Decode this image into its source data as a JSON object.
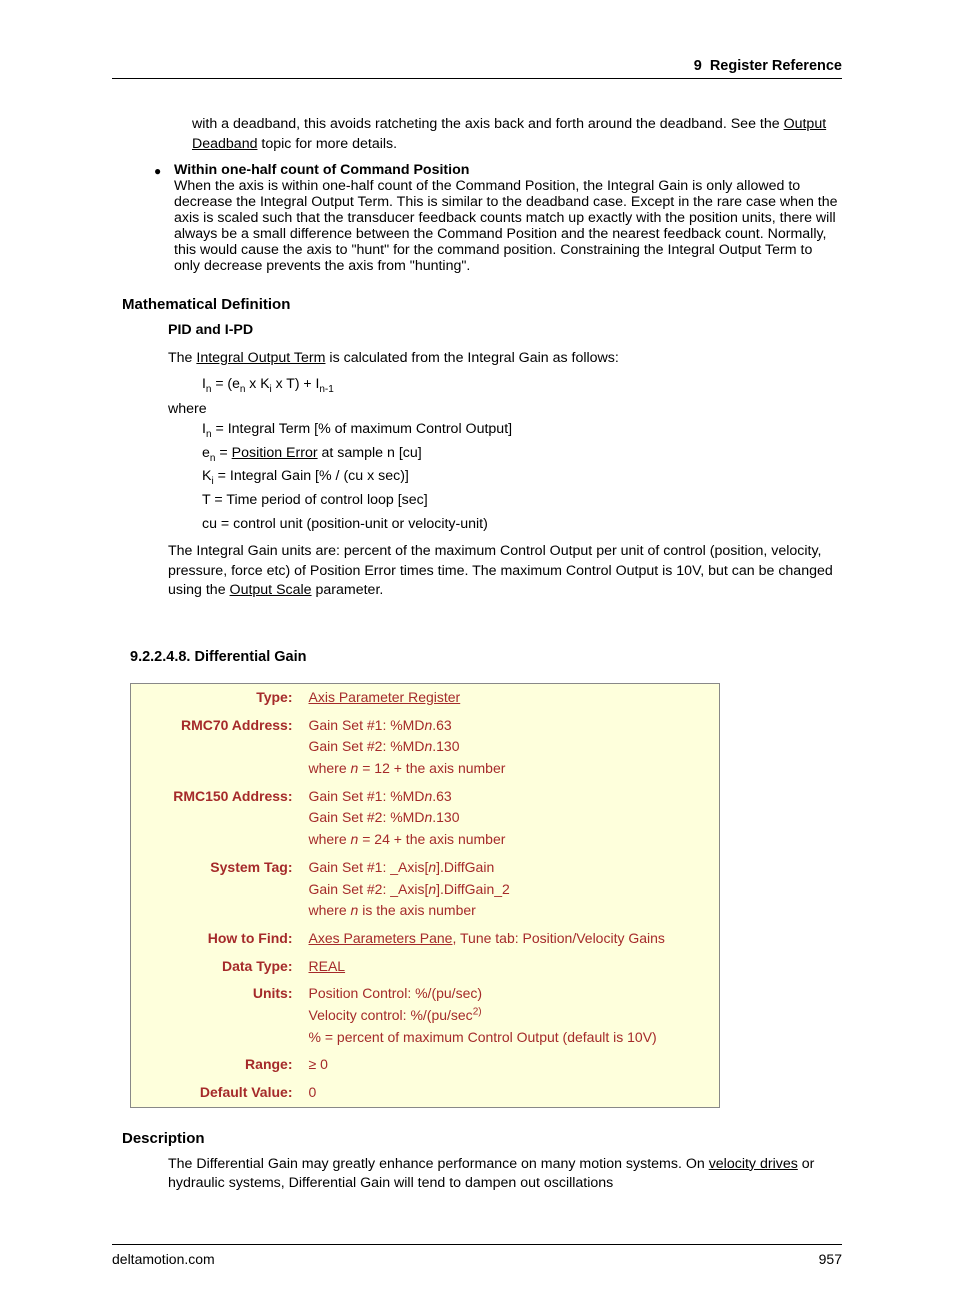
{
  "header": {
    "chapter": "9",
    "title": "Register Reference"
  },
  "intro": {
    "p1a": "with a deadband, this avoids ratcheting the axis back and forth around the deadband. See the ",
    "p1link": "Output Deadband",
    "p1b": " topic for more details."
  },
  "bullet": {
    "title": "Within one-half count of Command Position",
    "body": "When the axis is within one-half count of the Command Position, the Integral Gain is only allowed to decrease the Integral Output Term. This is similar to the deadband case. Except in the rare case when the axis is scaled such that the transducer feedback counts match up exactly with the position units, there will always be a small difference between the Command Position and the nearest feedback count. Normally, this would cause the axis to \"hunt\" for the command position. Constraining the Integral Output Term to only decrease prevents the axis from \"hunting\"."
  },
  "math": {
    "heading": "Mathematical Definition",
    "sub": "PID and I-PD",
    "lead_a": "The ",
    "lead_link": "Integral Output Term",
    "lead_b": " is calculated from the Integral Gain as follows:",
    "formula_plain": "I_n = (e_n x K_i x T) + I_{n-1}",
    "where": "where",
    "defs": {
      "d1": "= Integral Term [% of maximum Control Output]",
      "d2a": "= ",
      "d2link": "Position Error",
      "d2b": " at sample n [cu]",
      "d3": "= Integral Gain [% / (cu x sec)]",
      "d4": "T = Time period of control loop [sec]",
      "d5": "cu = control unit (position-unit  or velocity-unit)"
    },
    "trail_a": "The Integral Gain units are: percent of the maximum Control Output per unit of control (position, velocity, pressure, force etc) of Position Error times time. The maximum Control Output is 10V, but can be changed using the ",
    "trail_link": "Output Scale",
    "trail_b": " parameter."
  },
  "subsec": {
    "num": "9.2.2.4.8.",
    "title": "Differential Gain"
  },
  "table": {
    "rows": [
      {
        "label": "Type:",
        "html": "<span class='u'>Axis Parameter Register</span>"
      },
      {
        "label": "RMC70 Address:",
        "html": "Gain Set #1: %MD<span class='ital'>n</span>.63<br>Gain Set #2: %MD<span class='ital'>n</span>.130<br>where <span class='ital'>n</span> = 12 + the axis number"
      },
      {
        "label": "RMC150 Address:",
        "html": "Gain Set #1: %MD<span class='ital'>n</span>.63<br>Gain Set #2: %MD<span class='ital'>n</span>.130<br>where <span class='ital'>n</span> = 24 + the axis number"
      },
      {
        "label": "System Tag:",
        "html": "Gain Set #1: _Axis[<span class='ital'>n</span>].DiffGain<br>Gain Set #2: _Axis[<span class='ital'>n</span>].DiffGain_2<br>where <span class='ital'>n</span> is the axis number"
      },
      {
        "label": "How to Find:",
        "html": "<span class='u'>Axes Parameters Pane</span>, Tune tab: Position/Velocity Gains"
      },
      {
        "label": "Data Type:",
        "html": "<span class='u'>REAL</span>"
      },
      {
        "label": "Units:",
        "html": "Position Control: %/(pu/sec)<br>Velocity control: %/(pu/sec<sup>2)</sup><br>% = percent of maximum Control Output (default is 10V)"
      },
      {
        "label": "Range:",
        "html": "≥ 0"
      },
      {
        "label": "Default Value:",
        "html": "0"
      }
    ]
  },
  "desc": {
    "heading": "Description",
    "p1a": "The Differential Gain may greatly enhance performance on many motion systems. On ",
    "p1link": "velocity drives",
    "p1b": " or hydraulic systems, Differential Gain will tend to dampen out oscillations"
  },
  "footer": {
    "left": "deltamotion.com",
    "right": "957"
  }
}
